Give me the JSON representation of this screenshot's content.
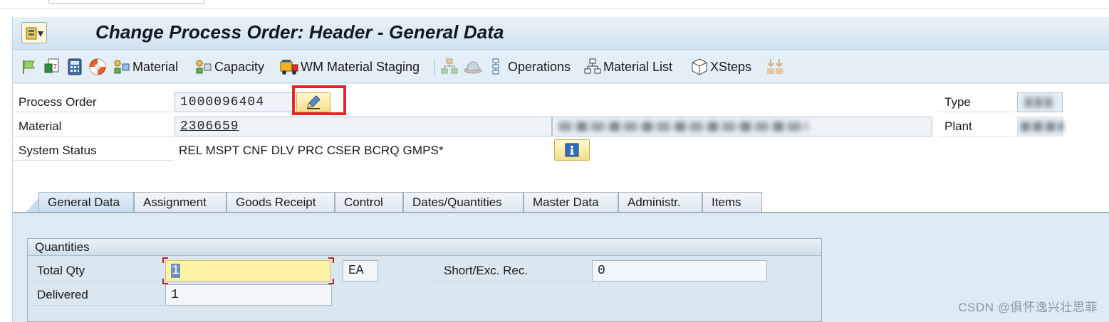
{
  "window": {
    "title": "Change Process Order: Header - General Data"
  },
  "toolbar": {
    "items": [
      {
        "icon": "flag-icon",
        "label": ""
      },
      {
        "icon": "document-icon",
        "label": ""
      },
      {
        "icon": "calculator-icon",
        "label": ""
      },
      {
        "icon": "lifebuoy-icon",
        "label": ""
      },
      {
        "icon": "material-icon",
        "label": "Material"
      },
      {
        "icon": "capacity-icon",
        "label": "Capacity"
      },
      {
        "icon": "truck-icon",
        "label": "WM Material Staging"
      },
      {
        "icon": "hierarchy-icon",
        "label": ""
      },
      {
        "icon": "hat-icon",
        "label": ""
      },
      {
        "icon": "operations-icon",
        "label": "Operations"
      },
      {
        "icon": "material-list-icon",
        "label": "Material List"
      },
      {
        "icon": "cube-icon",
        "label": "XSteps"
      },
      {
        "icon": "arrows-icon",
        "label": ""
      }
    ]
  },
  "header": {
    "process_order_label": "Process Order",
    "process_order_value": "1000096404",
    "material_label": "Material",
    "material_value": "2306659",
    "system_status_label": "System Status",
    "system_status_value": "REL  MSPT CNF  DLV  PRC  CSER BCRQ GMPS*",
    "type_label": "Type",
    "plant_label": "Plant"
  },
  "tabs": [
    {
      "label": "General Data",
      "active": true
    },
    {
      "label": "Assignment"
    },
    {
      "label": "Goods Receipt"
    },
    {
      "label": "Control"
    },
    {
      "label": "Dates/Quantities"
    },
    {
      "label": "Master Data"
    },
    {
      "label": "Administr."
    },
    {
      "label": "Items"
    }
  ],
  "quantities": {
    "group_title": "Quantities",
    "total_qty_label": "Total Qty",
    "total_qty_value": "1",
    "unit_value": "EA",
    "short_exc_label": "Short/Exc. Rec.",
    "short_exc_value": "0",
    "delivered_label": "Delivered",
    "delivered_value": "1"
  },
  "watermark": "CSDN @俱怀逸兴壮思菲",
  "colors": {
    "highlight_box": "#e8232a",
    "focus_field": "#fff3a8",
    "panel_bg": "#dfebf4"
  }
}
